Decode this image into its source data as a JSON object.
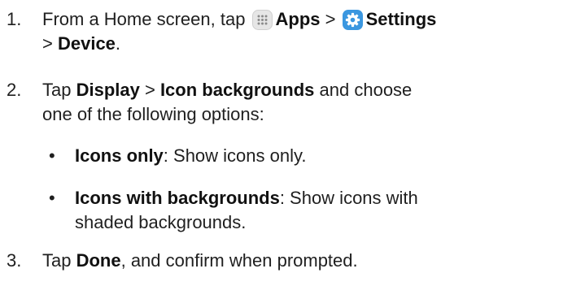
{
  "steps": [
    {
      "number": "1.",
      "parts": {
        "a": "From a Home screen, tap ",
        "apps": "Apps",
        "sep1": " > ",
        "settings": "Settings",
        "sep2": "> ",
        "device": "Device",
        "end": "."
      },
      "icons": [
        "apps-grid-icon",
        "settings-gear-icon"
      ]
    },
    {
      "number": "2.",
      "parts": {
        "a": "Tap ",
        "display": "Display",
        "sep": " > ",
        "icon_backgrounds": "Icon backgrounds",
        "b": " and choose",
        "c": "one of the following options:"
      }
    },
    {
      "number": "3.",
      "parts": {
        "a": "Tap ",
        "done": "Done",
        "b": ", and confirm when prompted."
      }
    }
  ],
  "options": [
    {
      "bullet": "•",
      "label": "Icons only",
      "desc": ": Show icons only."
    },
    {
      "bullet": "•",
      "label": "Icons with backgrounds",
      "desc1": ": Show icons with",
      "desc2": "shaded backgrounds."
    }
  ],
  "colors": {
    "text": "#1f1f1f",
    "settings_icon_bg": "#3b97e0",
    "apps_icon_bg": "#e4e4e4"
  }
}
